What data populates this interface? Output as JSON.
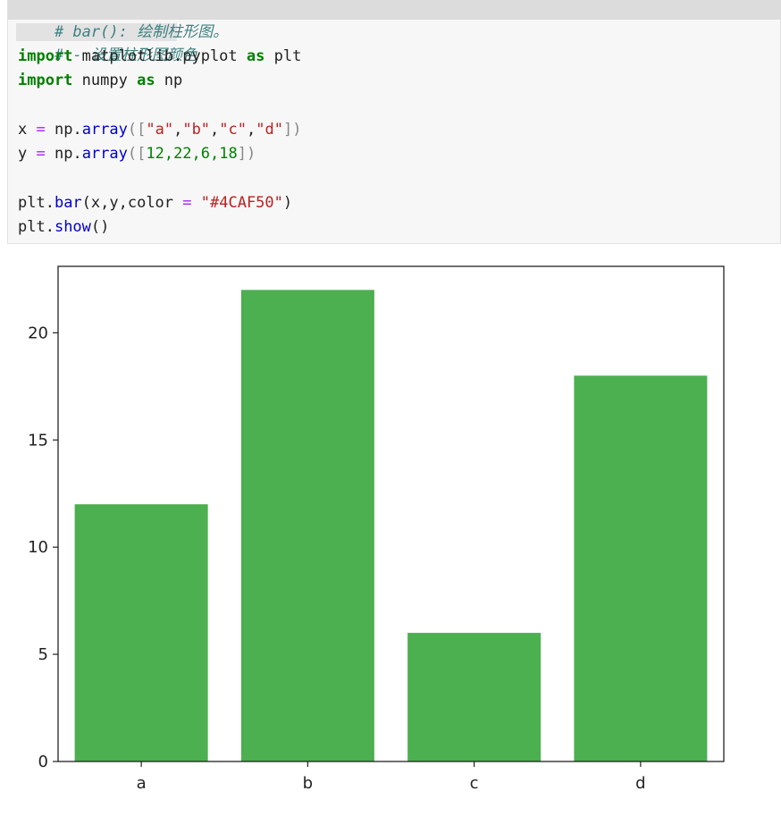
{
  "code": {
    "line1_comment": "# bar(): 绘制柱形图。",
    "line2_comment": "# - 设置柱形图颜色",
    "line3": {
      "kw": "import",
      "mod": " matplotlib.pyplot ",
      "as": "as",
      "alias": " plt"
    },
    "line4": {
      "kw": "import",
      "mod": " numpy ",
      "as": "as",
      "alias": " np"
    },
    "line5": {
      "var": "x",
      "eq": " = ",
      "call": "np.",
      "fn": "array",
      "open": "([",
      "s1": "\"a\"",
      "c1": ",",
      "s2": "\"b\"",
      "c2": ",",
      "s3": "\"c\"",
      "c3": ",",
      "s4": "\"d\"",
      "close": "])"
    },
    "line6": {
      "var": "y",
      "eq": " = ",
      "call": "np.",
      "fn": "array",
      "open": "([",
      "nums": "12,22,6,18",
      "close": "])"
    },
    "line7": {
      "pre": "plt.",
      "fn": "bar",
      "args": "(x,y,color ",
      "eq": "=",
      "sp": " ",
      "str": "\"#4CAF50\"",
      "close": ")"
    },
    "line8": {
      "pre": "plt.",
      "fn": "show",
      "args": "()"
    }
  },
  "chart_data": {
    "type": "bar",
    "categories": [
      "a",
      "b",
      "c",
      "d"
    ],
    "values": [
      12,
      22,
      6,
      18
    ],
    "color": "#4CAF50",
    "ylim": [
      0,
      23.1
    ],
    "yticks": [
      0,
      5,
      10,
      15,
      20
    ],
    "ytick_labels": [
      "0",
      "5",
      "10",
      "15",
      "20"
    ],
    "title": "",
    "xlabel": "",
    "ylabel": "",
    "grid": false,
    "legend": false
  }
}
